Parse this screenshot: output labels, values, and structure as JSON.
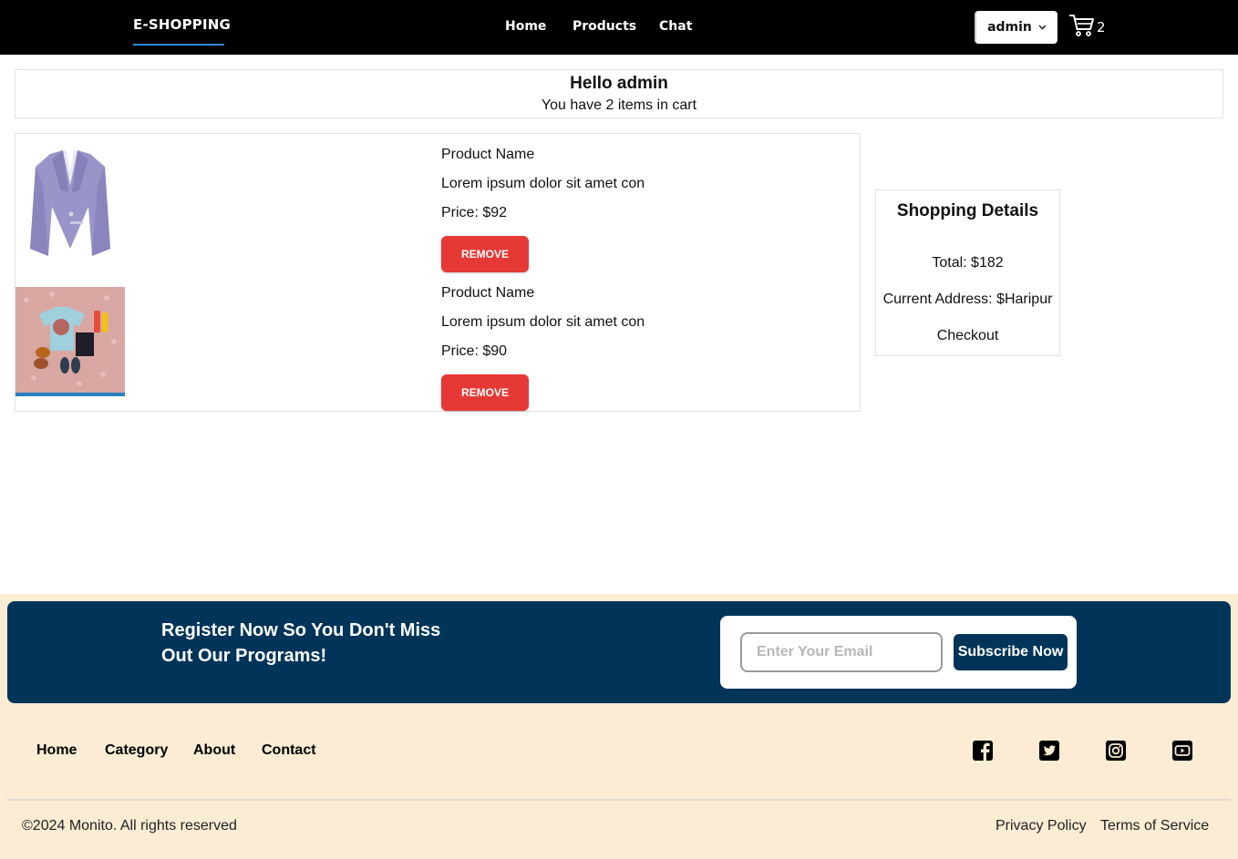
{
  "navbar": {
    "brand": "E-SHOPPING",
    "links": [
      "Home",
      "Products",
      "Chat"
    ],
    "user_label": "admin",
    "cart_count": "2"
  },
  "greeting": {
    "title": "Hello admin",
    "subtitle": "You have 2 items in cart"
  },
  "cart_items": [
    {
      "name": "Product Name",
      "description": "Lorem ipsum dolor sit amet con",
      "price": "Price: $92",
      "remove_label": "REMOVE",
      "image_icon": "blazer-image"
    },
    {
      "name": "Product Name",
      "description": "Lorem ipsum dolor sit amet con",
      "price": "Price: $90",
      "remove_label": "REMOVE",
      "image_icon": "outfit-flatlay-image"
    }
  ],
  "shopping_details": {
    "title": "Shopping Details",
    "total": "Total: $182",
    "address": "Current Address: $Haripur",
    "checkout": "Checkout"
  },
  "footer": {
    "banner_text": "Register Now So You Don't Miss Out Our Programs!",
    "email_placeholder": "Enter Your Email",
    "subscribe_label": "Subscribe Now",
    "links": [
      "Home",
      "Category",
      "About",
      "Contact"
    ],
    "social_icons": [
      "facebook-icon",
      "twitter-icon",
      "instagram-icon",
      "youtube-icon"
    ],
    "copyright": "©2024 Monito. All rights reserved",
    "privacy": "Privacy Policy",
    "terms": "Terms of Service"
  },
  "colors": {
    "navbar_bg": "#000000",
    "accent_blue": "#2f88d8",
    "remove_red": "#e53935",
    "banner_navy": "#003459",
    "footer_cream": "#fbecd3"
  }
}
